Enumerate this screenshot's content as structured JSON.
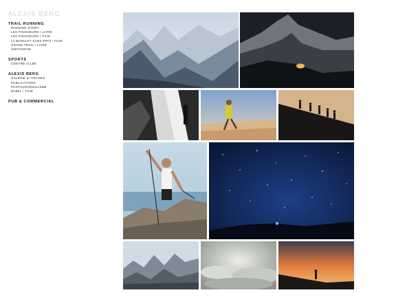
{
  "site": {
    "logo": "ALEXIS BERG"
  },
  "nav": {
    "sections": [
      {
        "label": "TRAIL-RUNNING",
        "items": [
          "RUNNING STORY",
          "LES FINISSEURS / LIVRE",
          "LES FINISSEURS / FILM",
          "LA BARKLEY SANS PIPO / FILM",
          "GRAND TRAIL / LIVRE",
          "INSTAGRAM"
        ]
      },
      {
        "label": "SPORTS",
        "items": [
          "CONTRE ALLEE"
        ]
      },
      {
        "label": "ALEXIS BERG",
        "items": [
          "GALERIE & TIRAGES",
          "PUBLICATIONS",
          "PHOTOJOURNALISME",
          "BABEL / FILM"
        ]
      },
      {
        "label": "PUB & COMMERCIAL",
        "items": []
      }
    ]
  },
  "gallery": {
    "photos": [
      {
        "name": "photo-mountain-range"
      },
      {
        "name": "photo-dark-peak-tent"
      },
      {
        "name": "photo-bw-waterfall-runner"
      },
      {
        "name": "photo-desert-runner"
      },
      {
        "name": "photo-ridge-silhouettes"
      },
      {
        "name": "photo-runner-poles-close"
      },
      {
        "name": "photo-starry-night"
      },
      {
        "name": "photo-dolomites"
      },
      {
        "name": "photo-cloud-sea"
      },
      {
        "name": "photo-sunset-runner"
      }
    ]
  }
}
